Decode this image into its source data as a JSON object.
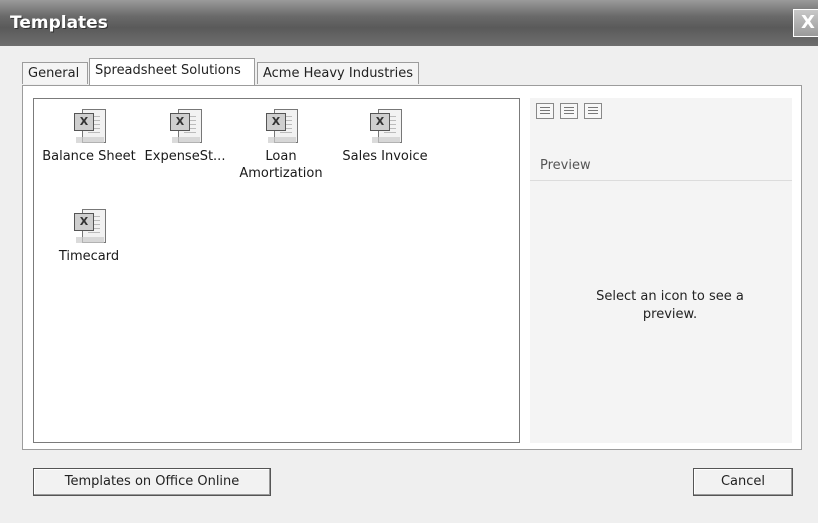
{
  "window": {
    "title": "Templates",
    "close_label": "X"
  },
  "tabs": [
    {
      "label": "General"
    },
    {
      "label": "Spreadsheet Solutions",
      "selected": true
    },
    {
      "label": "Acme Heavy Industries"
    }
  ],
  "templates": [
    {
      "label": "Balance Sheet",
      "icon": "excel-template-icon"
    },
    {
      "label": "ExpenseSt...",
      "icon": "excel-template-icon"
    },
    {
      "label": "Loan Amortization",
      "icon": "excel-template-icon"
    },
    {
      "label": "Sales Invoice",
      "icon": "excel-template-icon"
    },
    {
      "label": "Timecard",
      "icon": "excel-template-icon"
    }
  ],
  "preview": {
    "label": "Preview",
    "message": "Select an icon to see a preview.",
    "view_buttons": [
      "large-icons-view-icon",
      "list-view-icon",
      "details-view-icon"
    ]
  },
  "buttons": {
    "office_online": "Templates on Office Online",
    "cancel": "Cancel"
  }
}
